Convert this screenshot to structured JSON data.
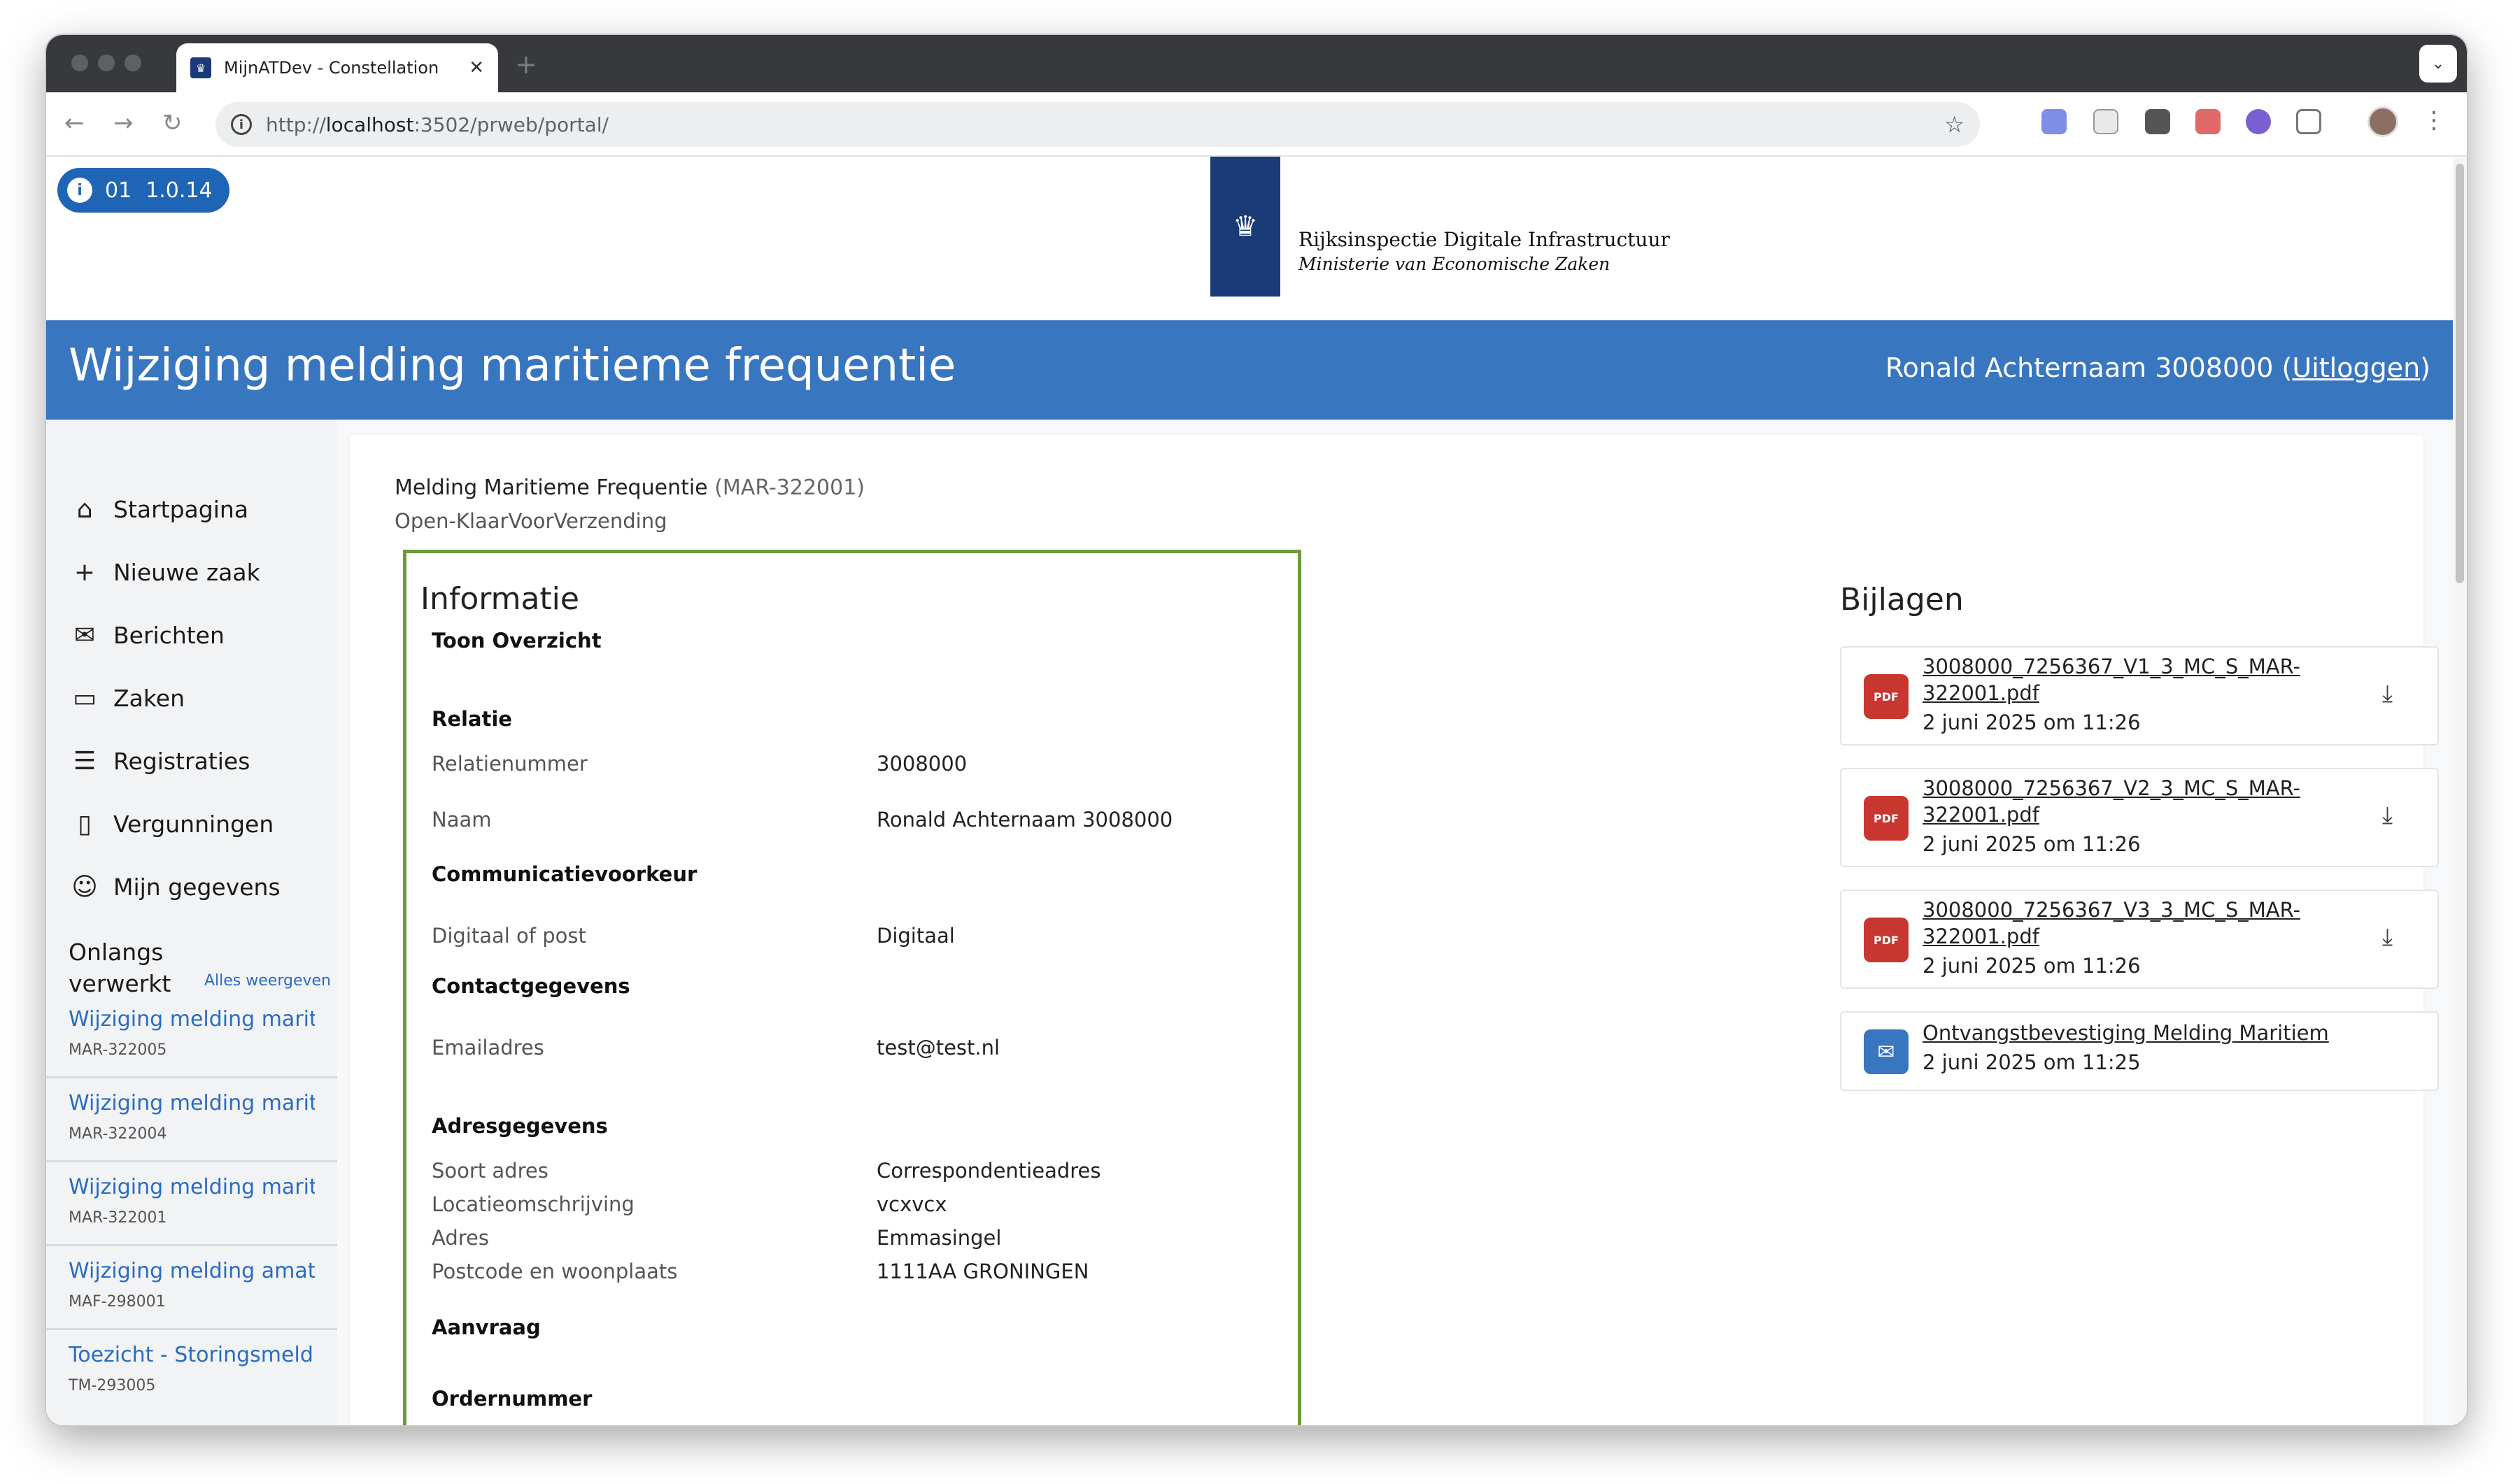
{
  "browser": {
    "tab_title": "MijnATDev - Constellation",
    "url_prefix": "http://",
    "url_host": "localhost",
    "url_rest": ":3502/prweb/portal/"
  },
  "version_badge": {
    "env": "01",
    "version": "1.0.14"
  },
  "logo": {
    "line1": "Rijksinspectie Digitale Infrastructuur",
    "line2": "Ministerie van Economische Zaken"
  },
  "banner": {
    "title": "Wijziging melding maritieme frequentie",
    "user": "Ronald Achternaam 3008000",
    "logout": "Uitloggen"
  },
  "nav": [
    {
      "label": "Startpagina",
      "icon": "home-icon"
    },
    {
      "label": "Nieuwe zaak",
      "icon": "plus-icon"
    },
    {
      "label": "Berichten",
      "icon": "mail-icon"
    },
    {
      "label": "Zaken",
      "icon": "briefcase-icon"
    },
    {
      "label": "Registraties",
      "icon": "list-icon"
    },
    {
      "label": "Vergunningen",
      "icon": "document-icon"
    },
    {
      "label": "Mijn gegevens",
      "icon": "user-icon"
    }
  ],
  "recent": {
    "title": "Onlangs verwerkt",
    "view_all": "Alles weergeven",
    "items": [
      {
        "title": "Wijziging melding mariti...",
        "id": "MAR-322005"
      },
      {
        "title": "Wijziging melding mariti...",
        "id": "MAR-322004"
      },
      {
        "title": "Wijziging melding mariti...",
        "id": "MAR-322001"
      },
      {
        "title": "Wijziging melding amate...",
        "id": "MAF-298001"
      },
      {
        "title": "Toezicht - Storingsmelding",
        "id": "TM-293005"
      }
    ]
  },
  "case": {
    "name": "Melding Maritieme Frequentie",
    "id": "(MAR-322001)",
    "status": "Open-KlaarVoorVerzending"
  },
  "info": {
    "heading": "Informatie",
    "overview": "Toon Overzicht",
    "relatie": "Relatie",
    "relatienummer_label": "Relatienummer",
    "relatienummer": "3008000",
    "naam_label": "Naam",
    "naam": "Ronald Achternaam 3008000",
    "comm": "Communicatievoorkeur",
    "post_label": "Digitaal of post",
    "post": "Digitaal",
    "contact": "Contactgegevens",
    "email_label": "Emailadres",
    "email": "test@test.nl",
    "adres": "Adresgegevens",
    "soort_label": "Soort adres",
    "soort": "Correspondentieadres",
    "locatie_label": "Locatieomschrijving",
    "locatie": "vcxvcx",
    "adres_label": "Adres",
    "adres_val": "Emmasingel",
    "postcode_label": "Postcode en woonplaats",
    "postcode": "1111AA GRONINGEN",
    "aanvraag": "Aanvraag",
    "order": "Ordernummer"
  },
  "bijlagen": {
    "heading": "Bijlagen",
    "items": [
      {
        "type": "pdf-icon",
        "name": "3008000_7256367_V1_3_MC_S_MAR-322001.pdf",
        "date": "2 juni 2025 om 11:26"
      },
      {
        "type": "pdf-icon",
        "name": "3008000_7256367_V2_3_MC_S_MAR-322001.pdf",
        "date": "2 juni 2025 om 11:26"
      },
      {
        "type": "pdf-icon",
        "name": "3008000_7256367_V3_3_MC_S_MAR-322001.pdf",
        "date": "2 juni 2025 om 11:26"
      },
      {
        "type": "mail-icon",
        "name": "Ontvangstbevestiging Melding Maritiem",
        "date": "2 juni 2025 om 11:25"
      }
    ]
  }
}
